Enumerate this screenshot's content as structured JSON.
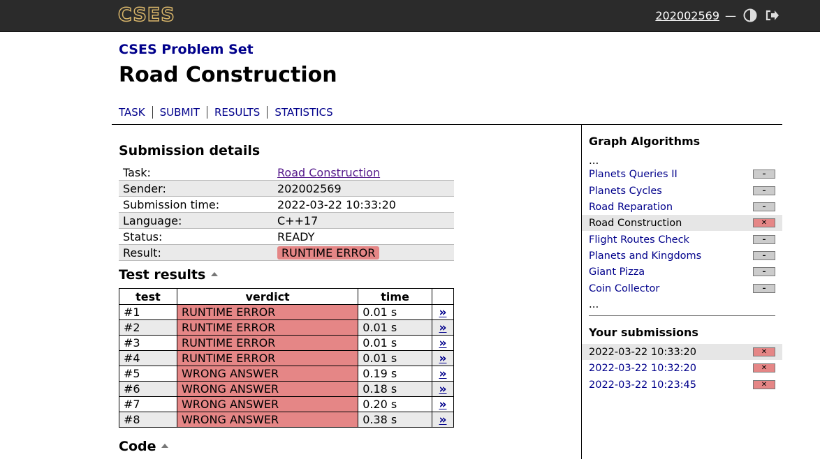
{
  "header": {
    "logo_text": "CSES",
    "username": "202002569",
    "dash": "—",
    "theme_icon": "contrast-icon",
    "logout_icon": "logout-icon"
  },
  "page": {
    "crumb": "CSES Problem Set",
    "title": "Road Construction",
    "tabs": [
      "TASK",
      "SUBMIT",
      "RESULTS",
      "STATISTICS"
    ]
  },
  "details": {
    "heading": "Submission details",
    "rows": [
      {
        "label": "Task:",
        "value": "Road Construction"
      },
      {
        "label": "Sender:",
        "value": "202002569"
      },
      {
        "label": "Submission time:",
        "value": "2022-03-22 10:33:20"
      },
      {
        "label": "Language:",
        "value": "C++17"
      },
      {
        "label": "Status:",
        "value": "READY"
      },
      {
        "label": "Result:",
        "value": "RUNTIME ERROR"
      }
    ]
  },
  "results": {
    "heading": "Test results",
    "columns": [
      "test",
      "verdict",
      "time",
      ""
    ],
    "rows": [
      {
        "test": "#1",
        "verdict": "RUNTIME ERROR",
        "time": "0.01 s",
        "arrow": "»"
      },
      {
        "test": "#2",
        "verdict": "RUNTIME ERROR",
        "time": "0.01 s",
        "arrow": "»"
      },
      {
        "test": "#3",
        "verdict": "RUNTIME ERROR",
        "time": "0.01 s",
        "arrow": "»"
      },
      {
        "test": "#4",
        "verdict": "RUNTIME ERROR",
        "time": "0.01 s",
        "arrow": "»"
      },
      {
        "test": "#5",
        "verdict": "WRONG ANSWER",
        "time": "0.19 s",
        "arrow": "»"
      },
      {
        "test": "#6",
        "verdict": "WRONG ANSWER",
        "time": "0.18 s",
        "arrow": "»"
      },
      {
        "test": "#7",
        "verdict": "WRONG ANSWER",
        "time": "0.20 s",
        "arrow": "»"
      },
      {
        "test": "#8",
        "verdict": "WRONG ANSWER",
        "time": "0.38 s",
        "arrow": "»"
      }
    ]
  },
  "code": {
    "heading": "Code"
  },
  "sidebar": {
    "section_title": "Graph Algorithms",
    "ellipsis": "...",
    "tasks": [
      {
        "label": "Planets Queries II",
        "status": "–",
        "bad": false,
        "active": false
      },
      {
        "label": "Planets Cycles",
        "status": "–",
        "bad": false,
        "active": false
      },
      {
        "label": "Road Reparation",
        "status": "–",
        "bad": false,
        "active": false
      },
      {
        "label": "Road Construction",
        "status": "✕",
        "bad": true,
        "active": true
      },
      {
        "label": "Flight Routes Check",
        "status": "–",
        "bad": false,
        "active": false
      },
      {
        "label": "Planets and Kingdoms",
        "status": "–",
        "bad": false,
        "active": false
      },
      {
        "label": "Giant Pizza",
        "status": "–",
        "bad": false,
        "active": false
      },
      {
        "label": "Coin Collector",
        "status": "–",
        "bad": false,
        "active": false
      }
    ],
    "submissions_title": "Your submissions",
    "submissions": [
      {
        "label": "2022-03-22 10:33:20",
        "status": "✕",
        "bad": true,
        "active": true
      },
      {
        "label": "2022-03-22 10:32:20",
        "status": "✕",
        "bad": true,
        "active": false
      },
      {
        "label": "2022-03-22 10:23:45",
        "status": "✕",
        "bad": true,
        "active": false
      }
    ]
  },
  "colors": {
    "accent": "#00008b",
    "error": "#e58686",
    "topbar": "#2b2b2b"
  }
}
